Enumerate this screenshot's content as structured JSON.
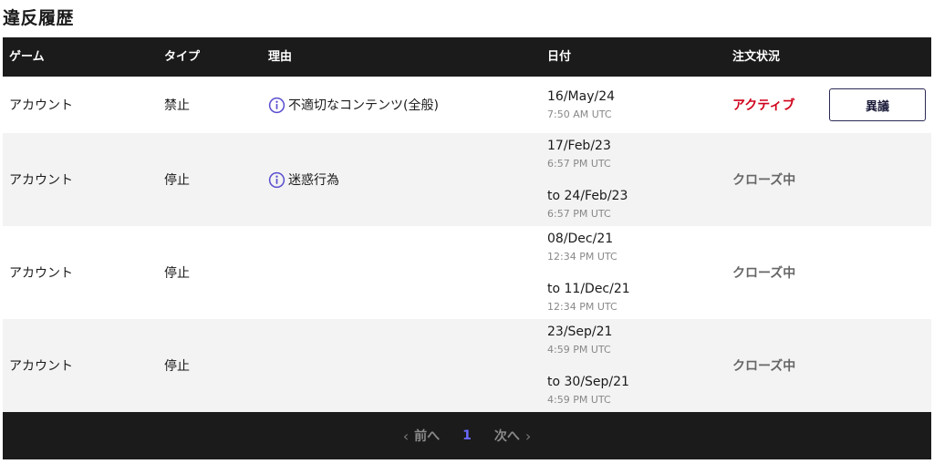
{
  "title": "違反履歴",
  "headers": {
    "game": "ゲーム",
    "type": "タイプ",
    "reason": "理由",
    "date": "日付",
    "status": "注文状況"
  },
  "rows": [
    {
      "game": "アカウント",
      "type": "禁止",
      "reason": "不適切なコンテンツ(全般)",
      "date1": "16/May/24",
      "time1": "7:50 AM UTC",
      "date2": "",
      "time2": "",
      "status": "アクティブ",
      "action": "異議"
    },
    {
      "game": "アカウント",
      "type": "停止",
      "reason": "迷惑行為",
      "date1": "17/Feb/23",
      "time1": "6:57 PM UTC",
      "date2": "to 24/Feb/23",
      "time2": "6:57 PM UTC",
      "status": "クローズ中"
    },
    {
      "game": "アカウント",
      "type": "停止",
      "reason": "",
      "date1": "08/Dec/21",
      "time1": "12:34 PM UTC",
      "date2": "to 11/Dec/21",
      "time2": "12:34 PM UTC",
      "status": "クローズ中"
    },
    {
      "game": "アカウント",
      "type": "停止",
      "reason": "",
      "date1": "23/Sep/21",
      "time1": "4:59 PM UTC",
      "date2": "to 30/Sep/21",
      "time2": "4:59 PM UTC",
      "status": "クローズ中"
    }
  ],
  "pagination": {
    "prev": "前へ",
    "current": "1",
    "next": "次へ"
  },
  "colors": {
    "header_bg": "#1b1b1b",
    "active_status": "#d0021b",
    "closed_status": "#666666",
    "page_current": "#6a6aff",
    "info_icon": "#5a4fcf"
  }
}
